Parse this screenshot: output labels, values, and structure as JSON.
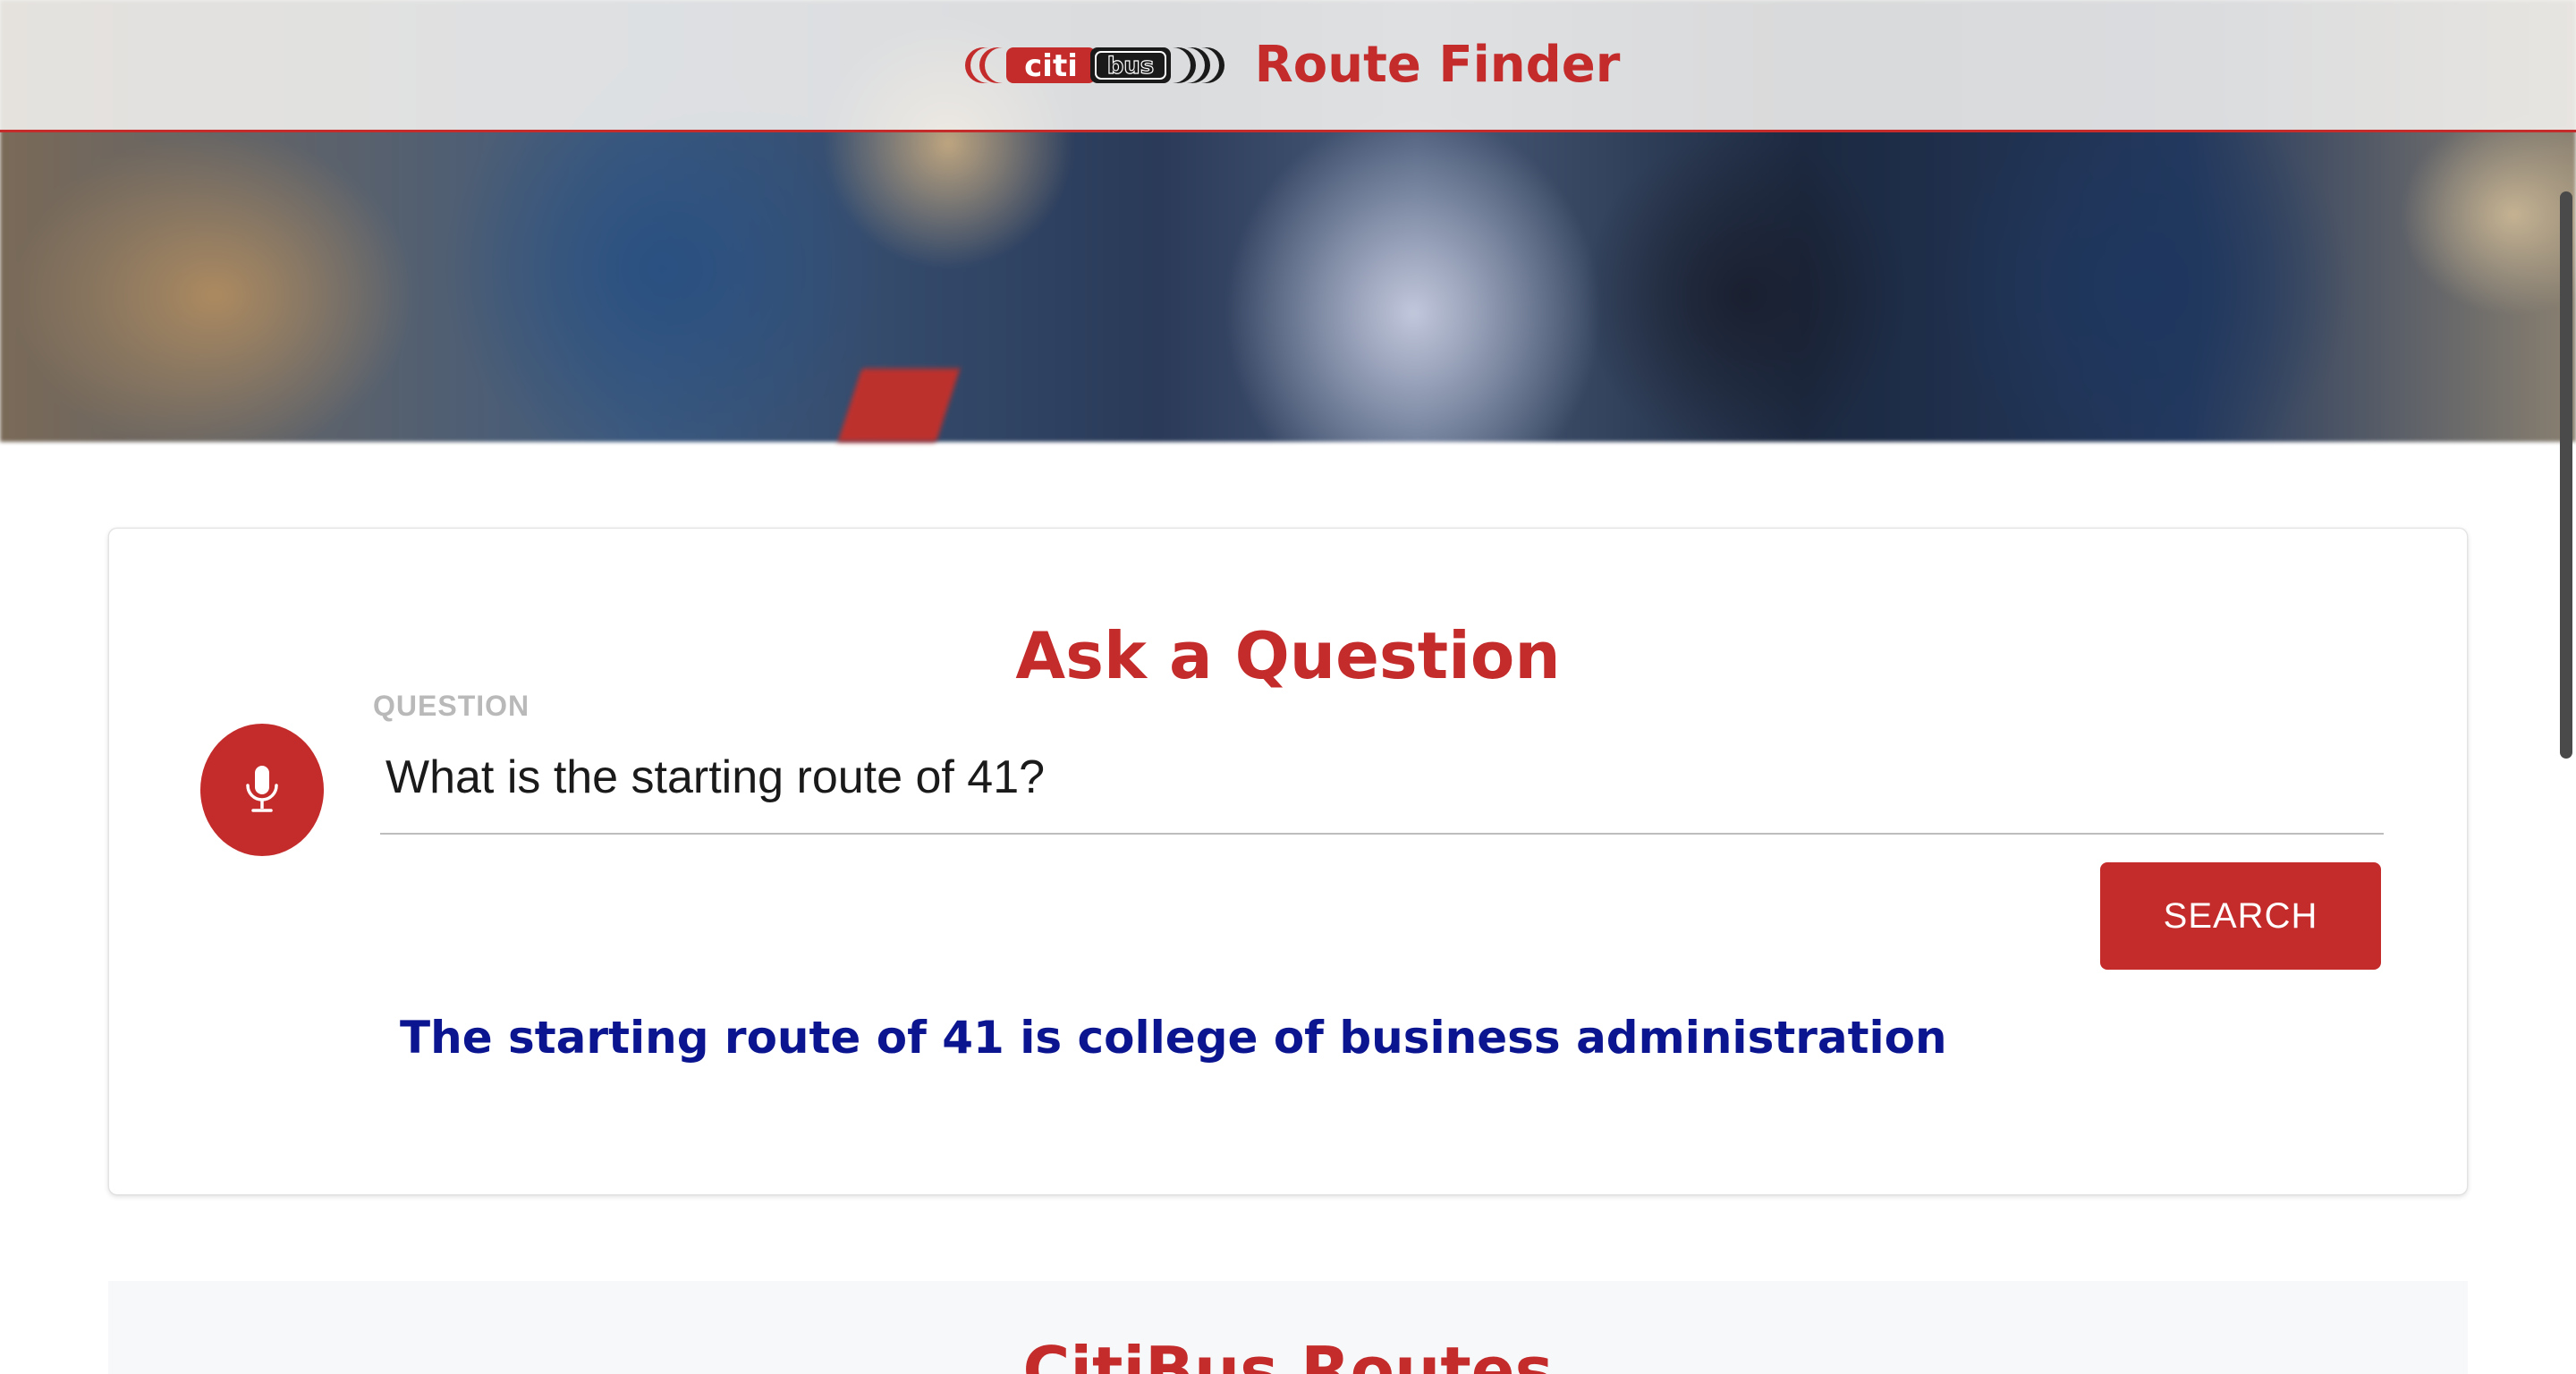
{
  "header": {
    "logo_alt": "citibus",
    "title": "Route Finder"
  },
  "question_card": {
    "heading": "Ask a Question",
    "field_label": "QUESTION",
    "question_value": "What is the starting route of 41?",
    "search_label": "SEARCH",
    "mic_icon": "microphone-icon",
    "answer": "The starting route of 41 is college of business administration"
  },
  "routes_section": {
    "heading": "CitiBus Routes"
  },
  "colors": {
    "brand_red": "#c42b2b",
    "answer_blue": "#0c1590"
  }
}
